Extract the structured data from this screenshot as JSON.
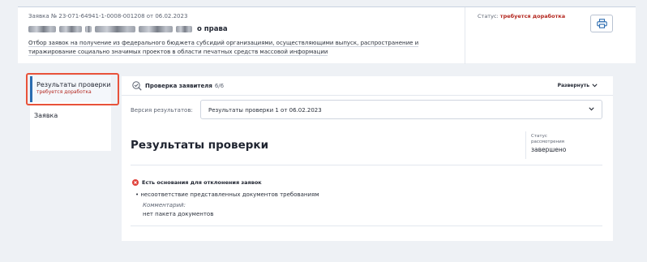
{
  "header": {
    "application_number": "Заявка № 23-071-64941-1-0008-001208 от 06.02.2023",
    "organization_suffix": "о права",
    "selection_description": "Отбор заявок на получение из федерального бюджета субсидий организациями, осуществляющими выпуск, распространение и тиражирование социально значимых проектов в области печатных средств массовой информации",
    "status_label": "Статус:",
    "status_value": "требуется доработка",
    "print_icon": "printer-icon",
    "status_color": "#b3261e"
  },
  "sidebar": {
    "items": [
      {
        "label": "Результаты проверки",
        "sublabel": "требуется доработка",
        "active": true
      },
      {
        "label": "Заявка"
      }
    ],
    "accent_color": "#2b6cb0",
    "highlight_color": "#e8523a"
  },
  "main": {
    "section_title": "Проверка заявителя",
    "section_count": "6/6",
    "expand_label": "Развернуть",
    "version_label": "Версия результатов:",
    "version_value": "Результаты проверки 1 от 06.02.2023",
    "results_title": "Результаты проверки",
    "review_status_label": "Статус рассмотрения",
    "review_status_value": "завершено",
    "reasons_title": "Есть основания для отклонения заявок",
    "reason_items": [
      "несоответствие представленных документов требованиям"
    ],
    "comment_label": "Комментарий:",
    "comment_text": "нет пакета документов",
    "error_color": "#e0403a"
  }
}
